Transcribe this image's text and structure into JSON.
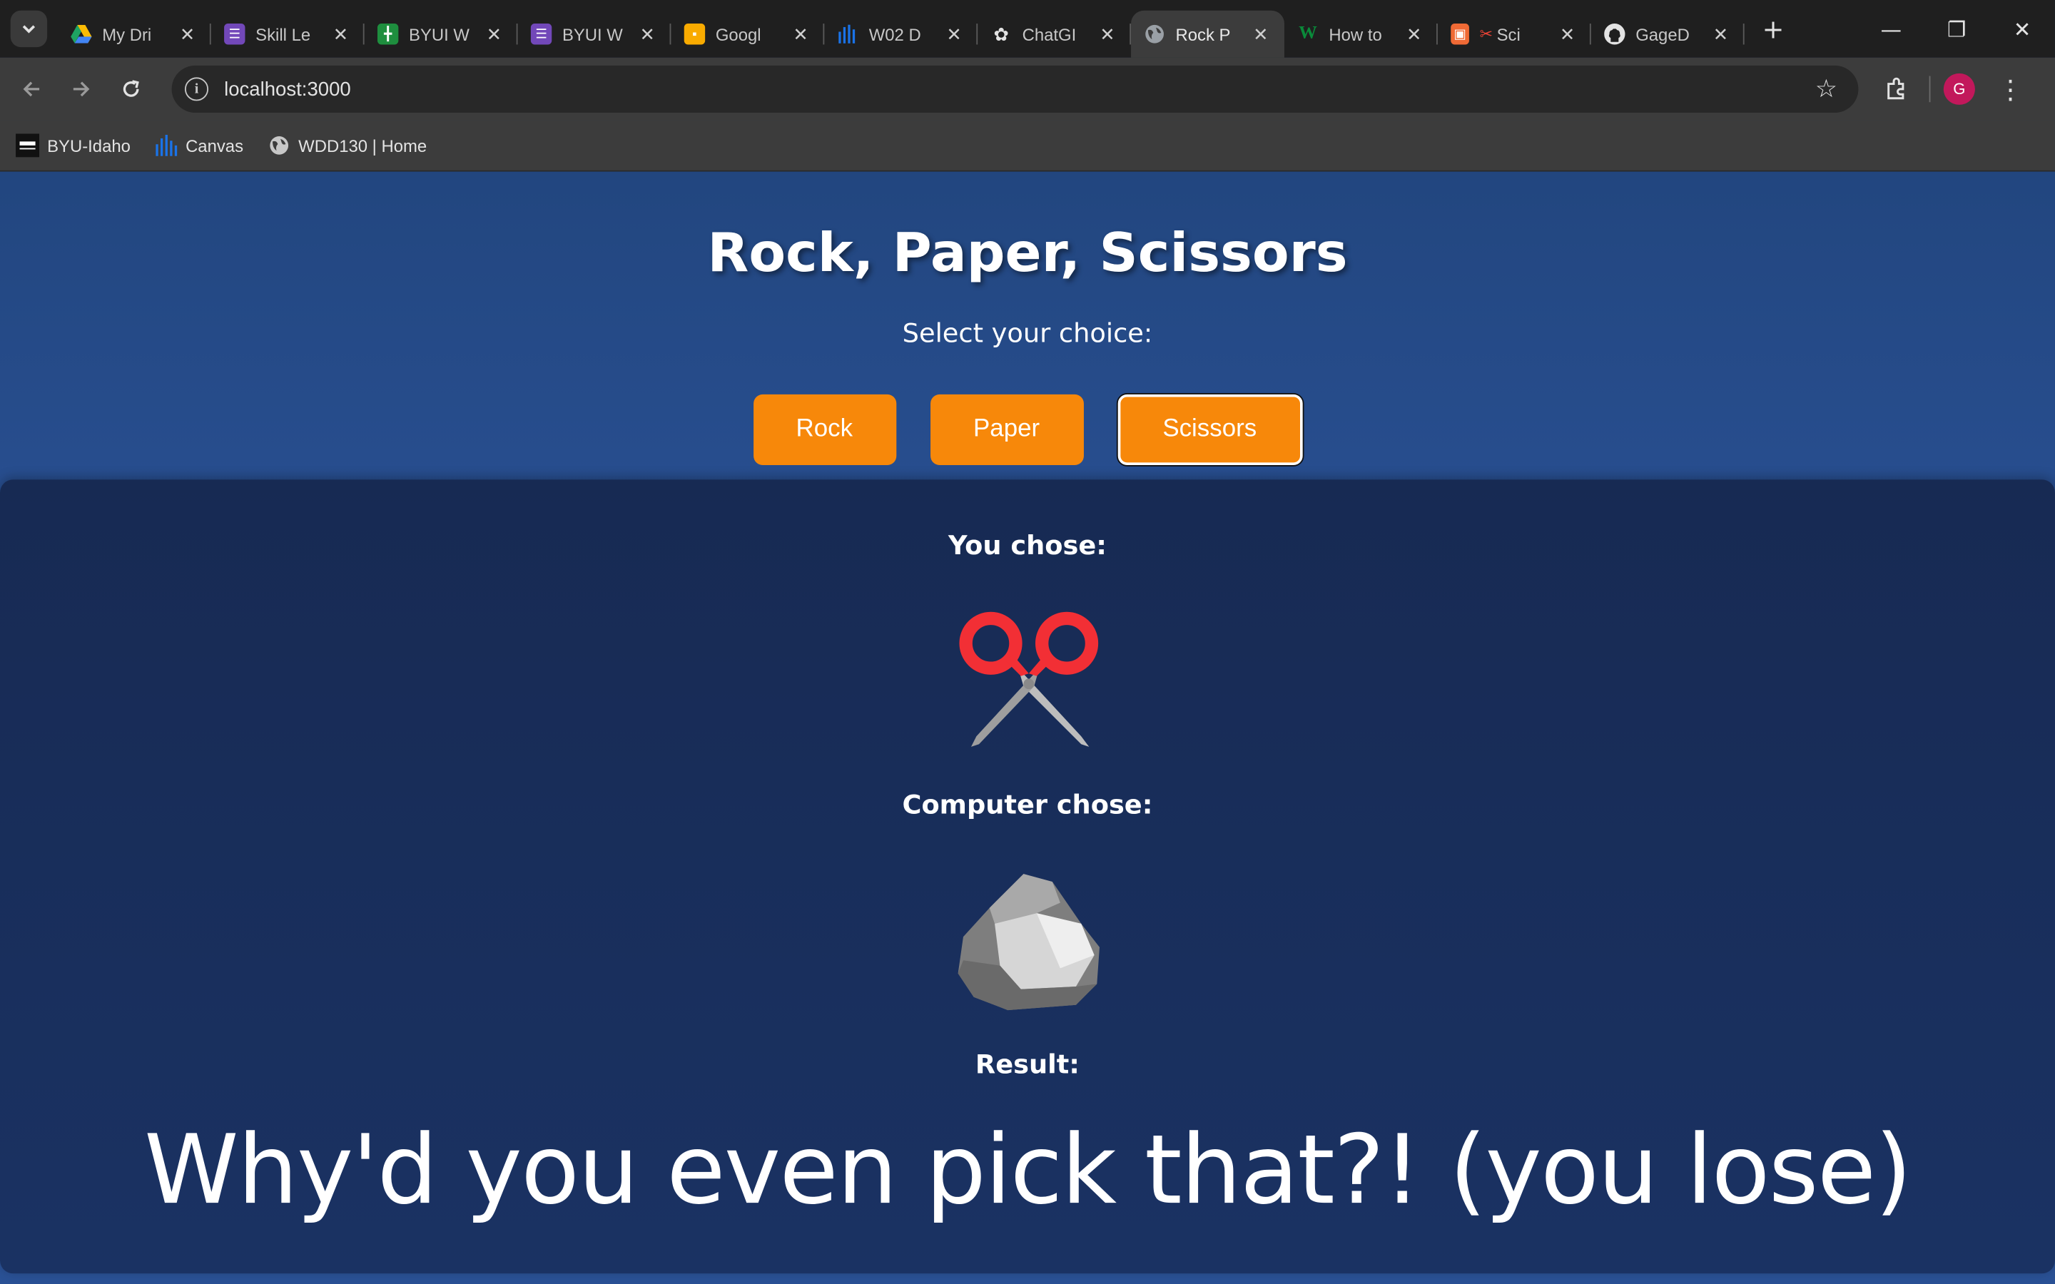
{
  "browser": {
    "tabs": [
      {
        "title": "My Dri",
        "icon": "google-drive-icon",
        "color": "#1a73e8"
      },
      {
        "title": "Skill Le",
        "icon": "forms-icon",
        "color": "#7248b9"
      },
      {
        "title": "BYUI W",
        "icon": "sheets-icon",
        "color": "#1e8e3e"
      },
      {
        "title": "BYUI W",
        "icon": "forms-icon",
        "color": "#7248b9"
      },
      {
        "title": "Googl",
        "icon": "slides-icon",
        "color": "#f9ab00"
      },
      {
        "title": "W02 D",
        "icon": "canvas-icon",
        "color": "#1a73e8"
      },
      {
        "title": "ChatGI",
        "icon": "chatgpt-icon",
        "color": "#e3e3e3"
      },
      {
        "title": "Rock P",
        "icon": "globe-icon",
        "color": "#9aa0a6",
        "active": true
      },
      {
        "title": "How to",
        "icon": "w-icon",
        "color": "#0a8a3a"
      },
      {
        "title": "Sci",
        "icon": "scissors-icon",
        "color": "#ea4335"
      },
      {
        "title": "GageD",
        "icon": "github-icon",
        "color": "#e3e3e3"
      }
    ],
    "url": "localhost:3000",
    "avatar_letter": "G",
    "bookmarks": [
      {
        "label": "BYU-Idaho",
        "icon": "byu-logo-icon"
      },
      {
        "label": "Canvas",
        "icon": "canvas-icon"
      },
      {
        "label": "WDD130 | Home",
        "icon": "globe-icon"
      }
    ]
  },
  "game": {
    "title": "Rock, Paper, Scissors",
    "prompt": "Select your choice:",
    "buttons": {
      "rock": "Rock",
      "paper": "Paper",
      "scissors": "Scissors"
    },
    "you_chose_label": "You chose:",
    "you_chose_icon": "scissors-icon",
    "computer_chose_label": "Computer chose:",
    "computer_chose_icon": "rock-icon",
    "result_label": "Result:",
    "result_text": "Why'd you even pick that?! (you lose)",
    "accent_color": "#f7880a"
  }
}
